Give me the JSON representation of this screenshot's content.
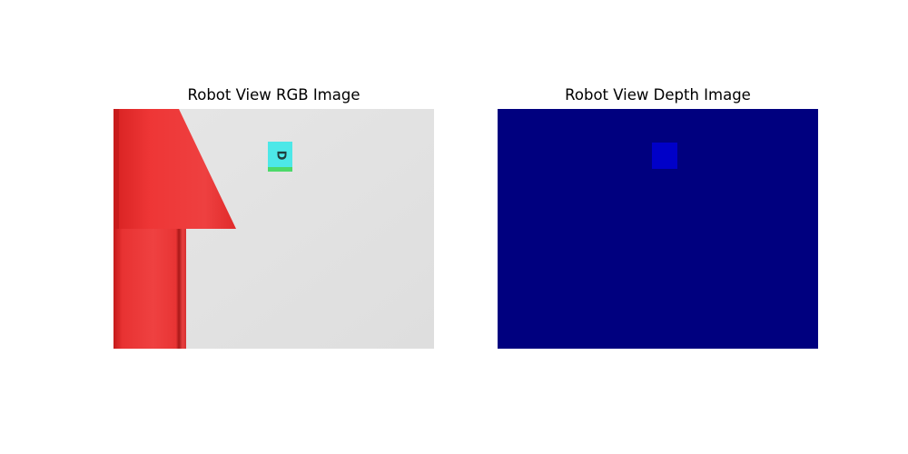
{
  "figure": {
    "rgb_title": "Robot View RGB Image",
    "depth_title": "Robot View Depth Image"
  },
  "rgb_scene": {
    "background_color": "#e1e1e1",
    "gripper_color": "#ee3333",
    "cube_color": "#4de8e8",
    "cube_base_color": "#4cd96a",
    "cube_letter": "D"
  },
  "depth_scene": {
    "background_color": "#00007f",
    "object_color": "#0000c8"
  }
}
